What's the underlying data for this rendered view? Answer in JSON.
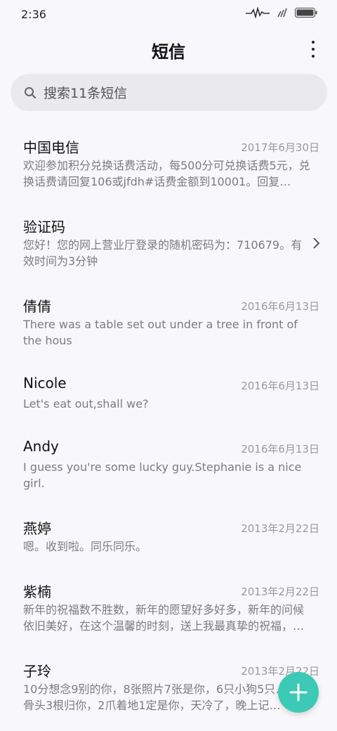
{
  "status": {
    "time": "2:36"
  },
  "header": {
    "title": "短信"
  },
  "search": {
    "placeholder": "搜索11条短信"
  },
  "messages": [
    {
      "name": "中国电信",
      "date": "2017年6月30日",
      "preview": "欢迎参加积分兑换话费活动，每500分可兑换话费5元，兑换话费请回复106或jfdh#话费金额到10001。回复…"
    },
    {
      "name": "验证码",
      "date": "",
      "preview": "您好！您的网上营业厅登录的随机密码为：710679。有效时间为3分钟"
    },
    {
      "name": "倩倩",
      "date": "2016年6月13日",
      "preview": "There was a table set out under a tree in front of the hous"
    },
    {
      "name": "Nicole",
      "date": "2016年6月13日",
      "preview": "Let's eat out,shall we?"
    },
    {
      "name": "Andy",
      "date": "2016年6月13日",
      "preview": "I guess you're some lucky guy.Stephanie is a nice girl."
    },
    {
      "name": "燕婷",
      "date": "2013年2月22日",
      "preview": "嗯。收到啦。同乐同乐。"
    },
    {
      "name": "紫楠",
      "date": "2013年2月22日",
      "preview": "新年的祝福数不胜数，新年的愿望好多好多，新年的问候依旧美好，在这个温馨的时刻，送上我最真挚的祝福，…"
    },
    {
      "name": "子玲",
      "date": "2013年2月22日",
      "preview": "10分想念9别的你，8张照片7张是你，6只小狗5只…4根骨头3根归你，2爪着地1定是你，天冷了，晚上记…"
    }
  ],
  "icons": {
    "search": "search-icon",
    "more": "more-vertical-icon",
    "chevron": "chevron-right-icon",
    "compose": "plus-icon"
  },
  "colors": {
    "accent": "#3cc9b5",
    "background": "#f8f8fc",
    "search_bg": "#e9e9ee"
  }
}
